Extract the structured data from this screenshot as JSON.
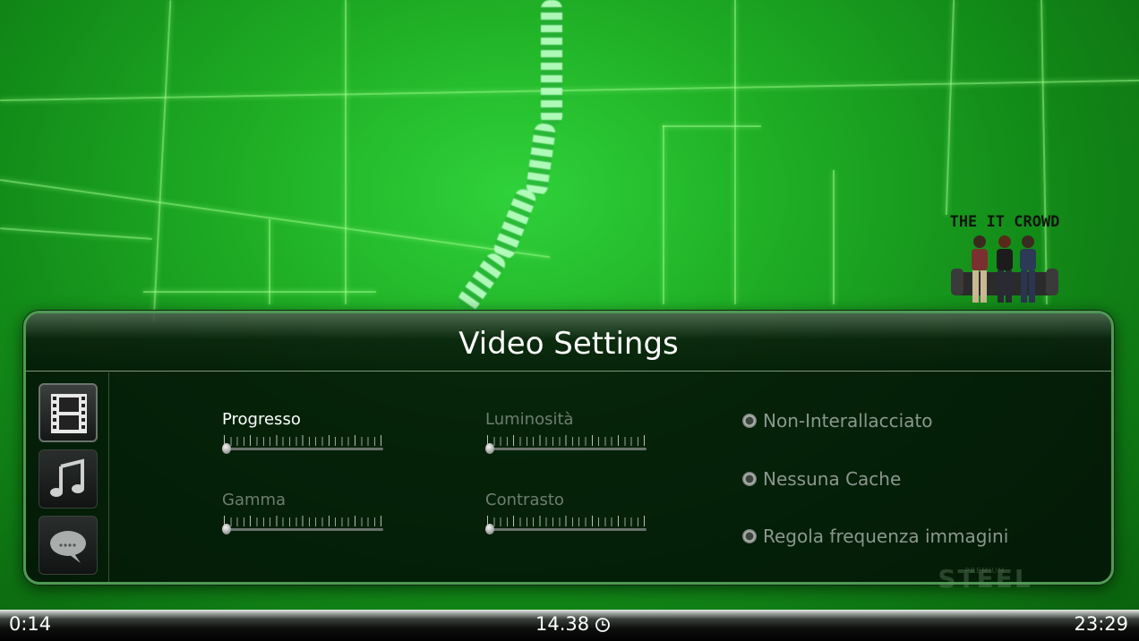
{
  "show_logo": {
    "title": "THE IT CROWD"
  },
  "dialog": {
    "title": "Video Settings",
    "side_menu": [
      {
        "name": "film-icon",
        "active": true
      },
      {
        "name": "music-note-icon",
        "active": false
      },
      {
        "name": "speech-bubble-icon",
        "active": false
      }
    ],
    "sliders": [
      {
        "label": "Progresso",
        "focused": true,
        "value": 0.0
      },
      {
        "label": "Luminosità",
        "focused": false,
        "value": 0.0
      },
      {
        "label": "Gamma",
        "focused": false,
        "value": 0.0
      },
      {
        "label": "Contrasto",
        "focused": false,
        "value": 0.0
      }
    ],
    "toggles": [
      {
        "label": "Non-Interallacciato"
      },
      {
        "label": "Nessuna Cache"
      },
      {
        "label": "Regola frequenza immagini"
      }
    ],
    "watermark": {
      "brand": "STEEL",
      "small": "PREMIUM"
    }
  },
  "status_bar": {
    "elapsed": "0:14",
    "clock": "14.38",
    "clock_icon": "clock-icon",
    "total": "23:29"
  },
  "colors": {
    "dialog_border": "#4f9a54",
    "label_active": "#ffffff",
    "label_inactive": "#6f7d72"
  }
}
